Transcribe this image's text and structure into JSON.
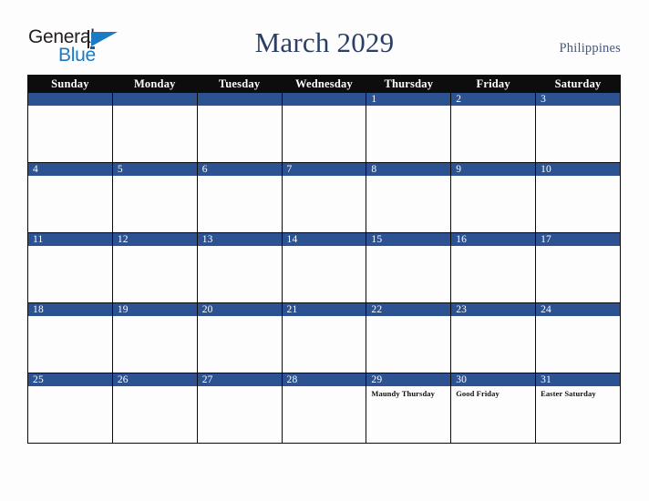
{
  "brand": {
    "word_one": "General",
    "word_two": "Blue",
    "mark": "triangle-logo-mark"
  },
  "header": {
    "title": "March 2029",
    "country": "Philippines"
  },
  "colors": {
    "accent_blue": "#2c5291",
    "header_black": "#0d0d0d",
    "title_navy": "#2b3f66",
    "logo_blue": "#1a7ac2",
    "page_background": "#fdfdfd"
  },
  "calendar": {
    "weekday_headers": [
      "Sunday",
      "Monday",
      "Tuesday",
      "Wednesday",
      "Thursday",
      "Friday",
      "Saturday"
    ],
    "weeks": [
      [
        {
          "day": "",
          "events": []
        },
        {
          "day": "",
          "events": []
        },
        {
          "day": "",
          "events": []
        },
        {
          "day": "",
          "events": []
        },
        {
          "day": "1",
          "events": []
        },
        {
          "day": "2",
          "events": []
        },
        {
          "day": "3",
          "events": []
        }
      ],
      [
        {
          "day": "4",
          "events": []
        },
        {
          "day": "5",
          "events": []
        },
        {
          "day": "6",
          "events": []
        },
        {
          "day": "7",
          "events": []
        },
        {
          "day": "8",
          "events": []
        },
        {
          "day": "9",
          "events": []
        },
        {
          "day": "10",
          "events": []
        }
      ],
      [
        {
          "day": "11",
          "events": []
        },
        {
          "day": "12",
          "events": []
        },
        {
          "day": "13",
          "events": []
        },
        {
          "day": "14",
          "events": []
        },
        {
          "day": "15",
          "events": []
        },
        {
          "day": "16",
          "events": []
        },
        {
          "day": "17",
          "events": []
        }
      ],
      [
        {
          "day": "18",
          "events": []
        },
        {
          "day": "19",
          "events": []
        },
        {
          "day": "20",
          "events": []
        },
        {
          "day": "21",
          "events": []
        },
        {
          "day": "22",
          "events": []
        },
        {
          "day": "23",
          "events": []
        },
        {
          "day": "24",
          "events": []
        }
      ],
      [
        {
          "day": "25",
          "events": []
        },
        {
          "day": "26",
          "events": []
        },
        {
          "day": "27",
          "events": []
        },
        {
          "day": "28",
          "events": []
        },
        {
          "day": "29",
          "events": [
            "Maundy Thursday"
          ]
        },
        {
          "day": "30",
          "events": [
            "Good Friday"
          ]
        },
        {
          "day": "31",
          "events": [
            "Easter Saturday"
          ]
        }
      ]
    ]
  }
}
